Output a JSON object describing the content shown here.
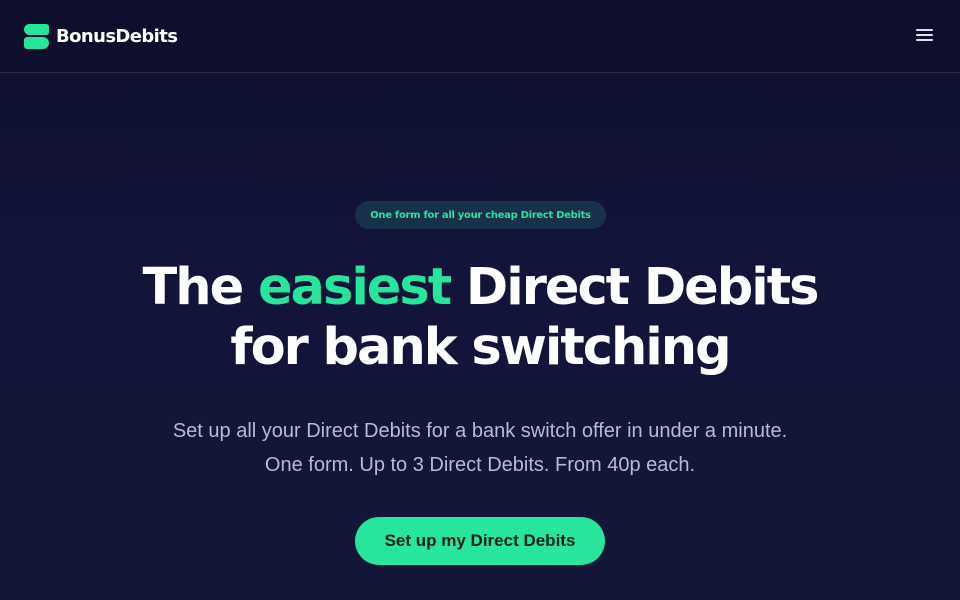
{
  "header": {
    "brand_name": "BonusDebits",
    "logo_icon": "stacked-bars-logo-icon",
    "menu_icon": "hamburger-menu-icon"
  },
  "hero": {
    "badge": "One form for all your cheap Direct Debits",
    "headline": {
      "prefix": "The ",
      "accent": "easiest",
      "suffix": " Direct Debits",
      "line2": "for bank switching"
    },
    "subtext": {
      "line1": "Set up all your Direct Debits for a bank switch offer in under a minute.",
      "line2": "One form. Up to 3 Direct Debits. From 40p each."
    },
    "cta_label": "Set up my Direct Debits"
  },
  "colors": {
    "background": "#0f1030",
    "accent": "#27e59a",
    "badge_background": "#18304a",
    "muted_text": "#b8bbd2"
  }
}
